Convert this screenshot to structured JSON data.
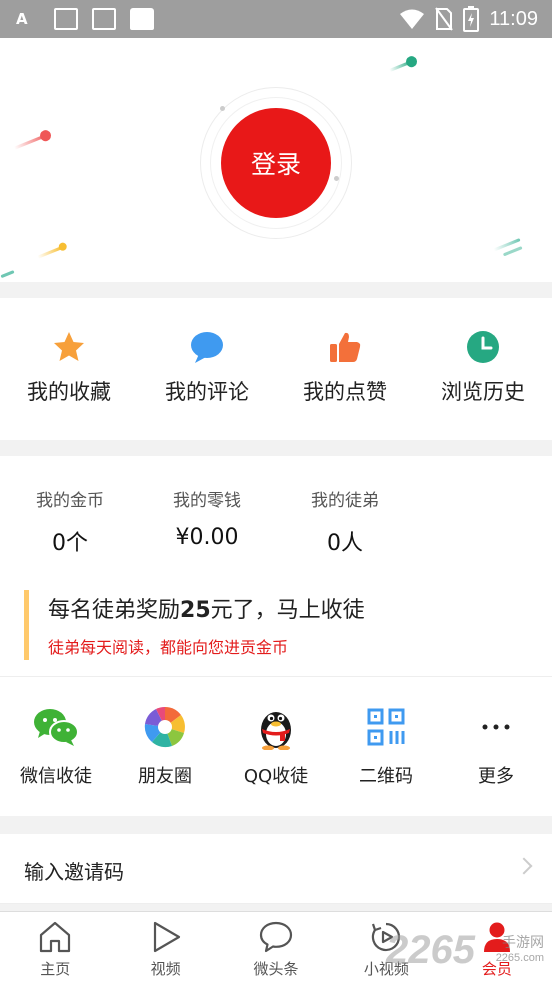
{
  "status_bar": {
    "time": "11:09",
    "left_icons": [
      "font-icon",
      "no-image-icon",
      "no-image-icon",
      "shopping-bag-icon"
    ],
    "right_icons": [
      "wifi-icon",
      "no-sim-icon",
      "battery-charging-icon"
    ]
  },
  "hero": {
    "login_label": "登录",
    "accent_red": "#e81818"
  },
  "menu": [
    {
      "label": "我的收藏",
      "icon": "star-icon",
      "color": "#f7a03b"
    },
    {
      "label": "我的评论",
      "icon": "comment-bubble-icon",
      "color": "#3f9af0"
    },
    {
      "label": "我的点赞",
      "icon": "thumbs-up-icon",
      "color": "#f3703a"
    },
    {
      "label": "浏览历史",
      "icon": "clock-icon",
      "color": "#26a882"
    }
  ],
  "stats": [
    {
      "label": "我的金币",
      "value": "0个"
    },
    {
      "label": "我的零钱",
      "value": "¥0.00"
    },
    {
      "label": "我的徒弟",
      "value": "0人"
    }
  ],
  "promo": {
    "title_prefix": "每名徒弟奖励",
    "title_amount": "25",
    "title_suffix": "元了，马上收徒",
    "subtitle": "徒弟每天阅读，都能向您进贡金币"
  },
  "shares": [
    {
      "label": "微信收徒",
      "icon": "wechat-icon"
    },
    {
      "label": "朋友圈",
      "icon": "moments-icon"
    },
    {
      "label": "QQ收徒",
      "icon": "qq-penguin-icon"
    },
    {
      "label": "二维码",
      "icon": "qr-code-icon"
    },
    {
      "label": "更多",
      "icon": "more-dots-icon"
    }
  ],
  "invite": {
    "label": "输入邀请码"
  },
  "bottom_nav": [
    {
      "label": "主页",
      "icon": "home-icon",
      "active": false
    },
    {
      "label": "视频",
      "icon": "play-icon",
      "active": false
    },
    {
      "label": "微头条",
      "icon": "chat-bubble-icon",
      "active": false
    },
    {
      "label": "小视频",
      "icon": "short-video-icon",
      "active": false
    },
    {
      "label": "会员",
      "icon": "member-icon",
      "active": true
    }
  ],
  "watermark": {
    "number": "2265",
    "text": "手游网",
    "url": "2265.com"
  }
}
